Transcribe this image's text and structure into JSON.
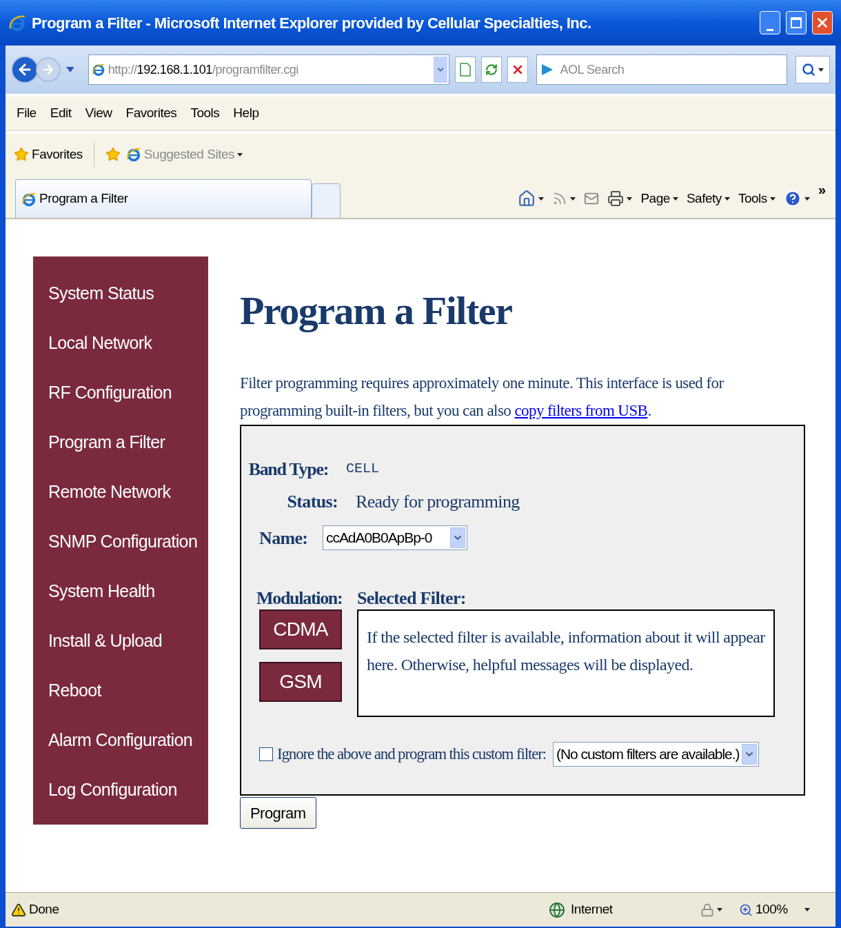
{
  "window": {
    "title": "Program a Filter - Microsoft Internet Explorer provided by Cellular Specialties, Inc."
  },
  "address_bar": {
    "scheme": "http://",
    "host": "192.168.1.101",
    "path": "/programfilter.cgi"
  },
  "search": {
    "placeholder": "AOL Search"
  },
  "menu": [
    "File",
    "Edit",
    "View",
    "Favorites",
    "Tools",
    "Help"
  ],
  "favorites_bar": {
    "favorites": "Favorites",
    "suggested_sites": "Suggested Sites"
  },
  "tabs": [
    {
      "label": "Program a Filter",
      "selected": true
    }
  ],
  "command_bar": {
    "items": [
      "Page",
      "Safety",
      "Tools"
    ],
    "overflow": "»"
  },
  "sidebar": {
    "items": [
      "System Status",
      "Local Network",
      "RF Configuration",
      "Program a Filter",
      "Remote Network",
      "SNMP Configuration",
      "System Health",
      "Install & Upload",
      "Reboot",
      "Alarm Configuration",
      "Log Configuration"
    ]
  },
  "heading": "Program a Filter",
  "intro": {
    "text": "Filter programming requires approximately one minute. This interface is used for programming built-in filters, but you can also ",
    "link": "copy filters from USB",
    "end": "."
  },
  "form": {
    "band_type": {
      "label": "Band Type:",
      "value": "CELL"
    },
    "status": {
      "label": "Status:",
      "value": "Ready for programming"
    },
    "name": {
      "label": "Name:",
      "value": "ccAdA0B0ApBp-0"
    },
    "modulation": {
      "label": "Modulation:",
      "buttons": [
        "CDMA",
        "GSM"
      ]
    },
    "selected_filter": {
      "label": "Selected Filter:",
      "message": "If the selected filter is available, information about it will appear here. Otherwise, helpful messages will be displayed."
    },
    "custom": {
      "label": "Ignore the above and program this custom filter:",
      "checked": false,
      "value": "(No custom filters are available.)"
    }
  },
  "program_button": "Program",
  "status_bar": {
    "status": "Done",
    "zone": "Internet",
    "zoom": "100%"
  }
}
